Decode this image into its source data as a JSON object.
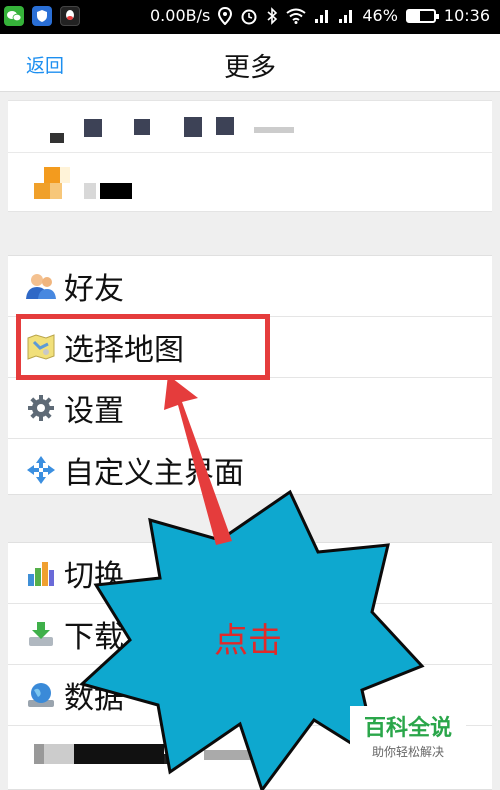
{
  "status_bar": {
    "network_speed": "0.00B/s",
    "battery_percent": "46%",
    "battery_level": 0.46,
    "time": "10:36",
    "icons": [
      "wechat-icon",
      "shield-icon",
      "qq-icon",
      "location-icon",
      "alarm-icon",
      "bluetooth-icon",
      "wifi-icon",
      "signal-icon",
      "signal-icon",
      "battery-icon"
    ]
  },
  "nav": {
    "back_label": "返回",
    "title": "更多"
  },
  "menu_group_1": [
    {
      "label": "好友",
      "icon": "friends-icon"
    },
    {
      "label": "选择地图",
      "icon": "map-icon"
    },
    {
      "label": "设置",
      "icon": "gear-icon"
    },
    {
      "label": "自定义主界面",
      "icon": "arrows-icon"
    }
  ],
  "menu_group_2": [
    {
      "label": "切换",
      "icon": "bar-chart-icon"
    },
    {
      "label": "下载",
      "icon": "download-icon"
    },
    {
      "label": "数据",
      "icon": "globe-icon"
    }
  ],
  "annotation": {
    "click_label": "点击",
    "highlight_color": "#e53c3c",
    "burst_color": "#0ea8cf"
  },
  "watermark": {
    "title": "百科全说",
    "subtitle": "助你轻松解决"
  }
}
